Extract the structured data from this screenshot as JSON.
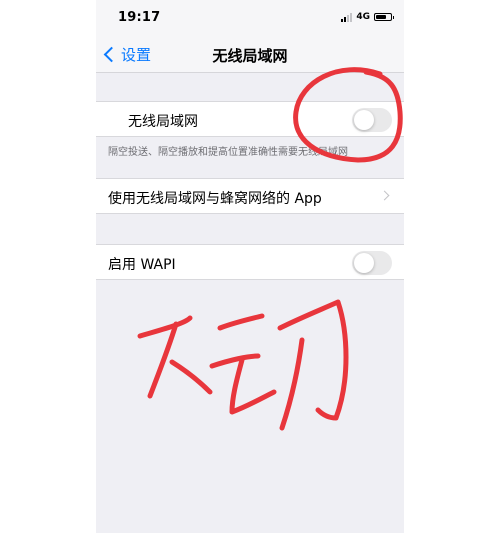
{
  "status_bar": {
    "time": "19:17",
    "network": "4G"
  },
  "nav": {
    "back_label": "设置",
    "title": "无线局域网"
  },
  "wlan_row": {
    "label": "无线局域网",
    "toggle_on": false,
    "footer": "隔空投送、隔空播放和提高位置准确性需要无线局域网"
  },
  "app_row": {
    "label": "使用无线局域网与蜂窝网络的 App"
  },
  "wapi_row": {
    "label": "启用 WAPI",
    "toggle_on": false
  },
  "annotation": {
    "handwriting": "不动",
    "ink_color": "#e8363c"
  }
}
